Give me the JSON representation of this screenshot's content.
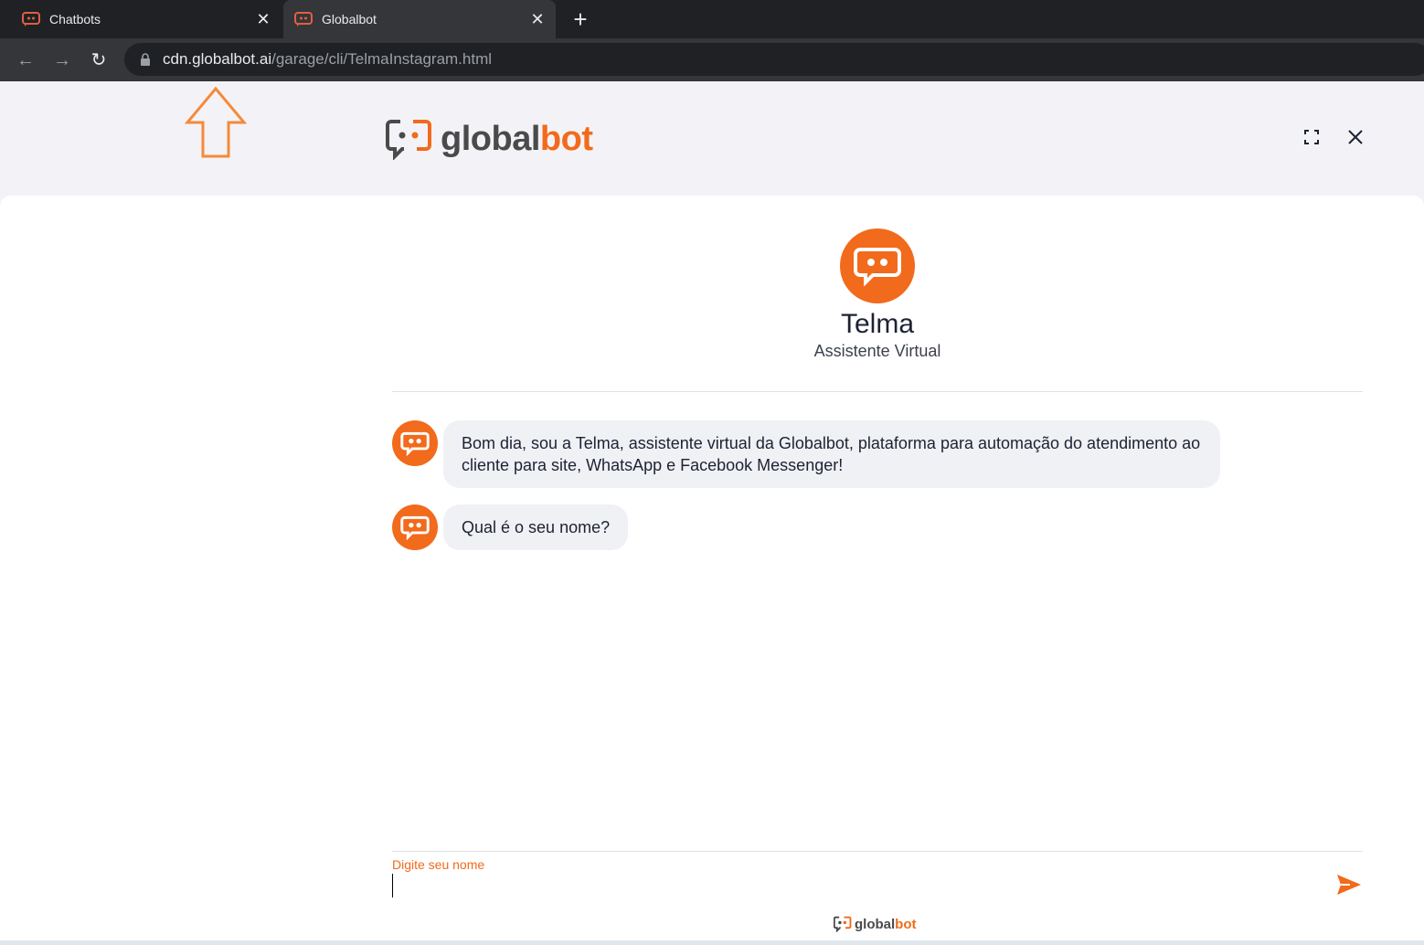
{
  "browser": {
    "tabs": [
      {
        "title": "Chatbots",
        "active": false
      },
      {
        "title": "Globalbot",
        "active": true
      }
    ],
    "url_host": "cdn.globalbot.ai",
    "url_path": "/garage/cli/TelmaInstagram.html"
  },
  "header": {
    "brand_prefix": "global",
    "brand_suffix": "bot"
  },
  "profile": {
    "name": "Telma",
    "role": "Assistente Virtual"
  },
  "messages": [
    {
      "text": "Bom dia, sou a Telma, assistente virtual da Globalbot, plataforma para automação do atendimento ao cliente para site, WhatsApp e Facebook Messenger!"
    },
    {
      "text": "Qual é o seu nome?"
    }
  ],
  "input": {
    "label": "Digite seu nome",
    "value": ""
  },
  "footer": {
    "brand_prefix": "global",
    "brand_suffix": "bot"
  },
  "colors": {
    "accent": "#f26a1b",
    "chrome_dark": "#202124",
    "chrome_toolbar": "#35363a",
    "bubble": "#f0f1f5"
  },
  "icons": [
    "globalbot-favicon",
    "close-icon",
    "plus-icon",
    "back-arrow-icon",
    "forward-arrow-icon",
    "reload-icon",
    "lock-icon",
    "expand-icon",
    "send-icon",
    "up-arrow-annotation"
  ]
}
